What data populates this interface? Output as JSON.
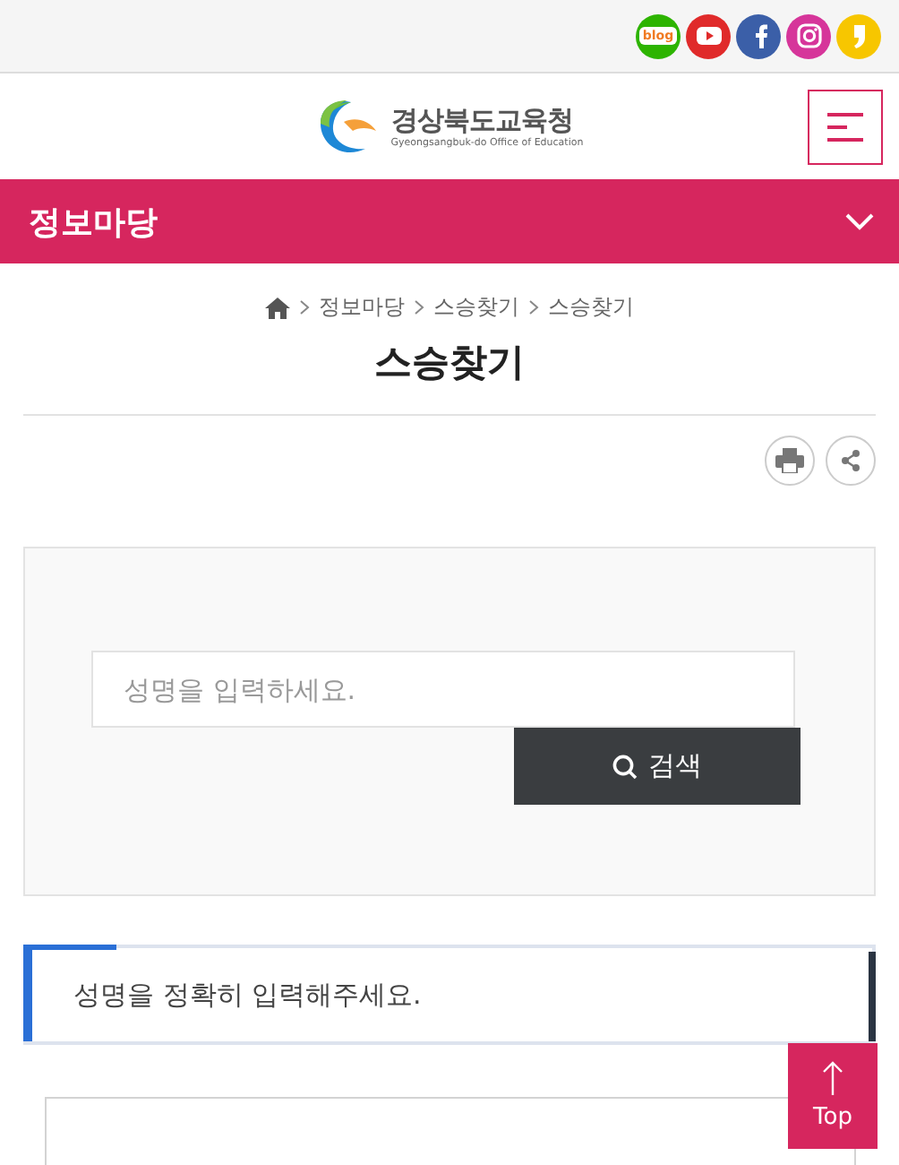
{
  "logo": {
    "name": "경상북도교육청",
    "subtitle": "Gyeongsangbuk-do Office of Education"
  },
  "social_links": [
    {
      "kind": "blog",
      "label": "blog",
      "color": "#2db400"
    },
    {
      "kind": "youtube",
      "color": "#e02a2a"
    },
    {
      "kind": "facebook",
      "color": "#3b5fa8"
    },
    {
      "kind": "instagram",
      "color": "#d6359a"
    },
    {
      "kind": "kakao",
      "color": "#f7c600"
    }
  ],
  "section_bar": {
    "title": "정보마당"
  },
  "breadcrumb": [
    "정보마당",
    "스승찾기",
    "스승찾기"
  ],
  "page_title": "스승찾기",
  "search": {
    "placeholder": "성명을 입력하세요.",
    "button": "검색"
  },
  "notice": "성명을 정확히 입력해주세요.",
  "top_button": "Top"
}
